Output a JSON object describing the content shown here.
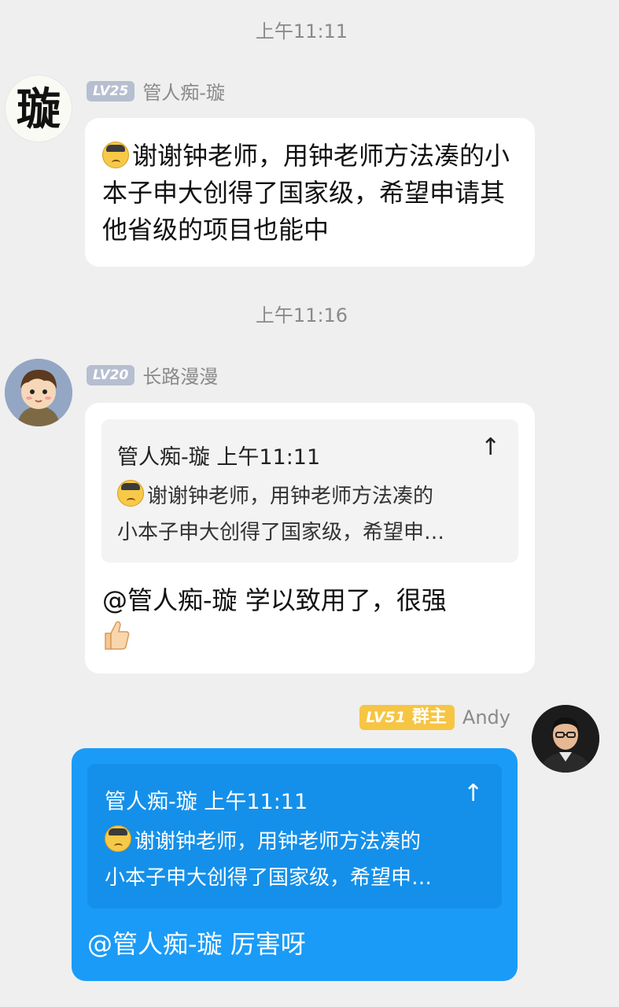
{
  "messages": [
    {
      "time": "上午11:11",
      "level": "LV25",
      "nickname": "管人痴-璇",
      "avatar_text": "璇",
      "text": "谢谢钟老师，用钟老师方法凑的小本子申大创得了国家级，希望申请其他省级的项目也能中"
    },
    {
      "time": "上午11:16",
      "level": "LV20",
      "nickname": "长路漫漫",
      "quote": {
        "author": "管人痴-璇",
        "time": "上午11:11",
        "line1": "谢谢钟老师，用钟老师方法凑的",
        "line2": "小本子申大创得了国家级，希望申…"
      },
      "text": "@管人痴-璇 学以致用了，很强",
      "thumb_icon": "thumbs-up-icon"
    },
    {
      "level": "LV51",
      "role": "群主",
      "nickname": "Andy",
      "quote": {
        "author": "管人痴-璇",
        "time": "上午11:11",
        "line1": "谢谢钟老师，用钟老师方法凑的",
        "line2": "小本子申大创得了国家级，希望申…"
      },
      "text": "@管人痴-璇 厉害呀"
    }
  ],
  "pin_icon": "↑",
  "colors": {
    "background": "#efefef",
    "self_bubble": "#1a9bf7",
    "owner_tag": "#f6c543",
    "level_tag": "#b6bfd0"
  }
}
